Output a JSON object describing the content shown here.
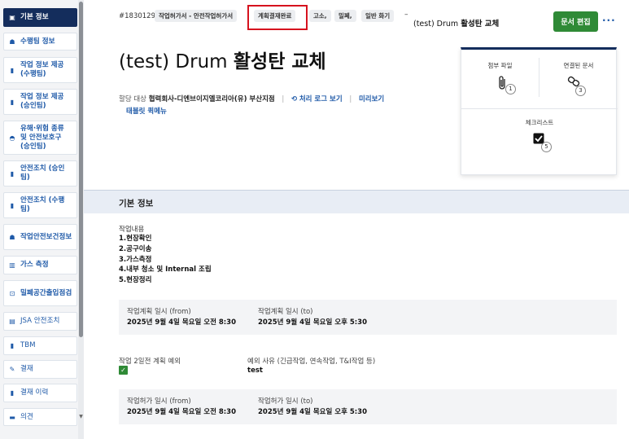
{
  "sidebar": {
    "items": [
      {
        "label": "기본 정보",
        "icon": "clipboard-icon"
      },
      {
        "label": "수행팀 정보",
        "icon": "team-icon"
      },
      {
        "label": "작업 정보 제공 (수행팀)",
        "icon": "document-icon"
      },
      {
        "label": "작업 정보 제공 (승인팀)",
        "icon": "document-icon"
      },
      {
        "label": "유해·위험 종류 및 안전보호구 (승인팀)",
        "icon": "goggles-icon"
      },
      {
        "label": "안전조치 (승인팀)",
        "icon": "document-icon"
      },
      {
        "label": "안전조치 (수행팀)",
        "icon": "document-icon"
      },
      {
        "label": "작업안전보건정보",
        "icon": "team-icon"
      },
      {
        "label": "가스 측정",
        "icon": "gas-icon"
      },
      {
        "label": "밀폐공간출입점검",
        "icon": "enter-icon"
      },
      {
        "label": "JSA 안전조치",
        "icon": "lock-icon"
      },
      {
        "label": "TBM",
        "icon": "document-icon"
      },
      {
        "label": "결재",
        "icon": "pen-icon"
      },
      {
        "label": "결재 이력",
        "icon": "document-icon"
      },
      {
        "label": "의견",
        "icon": "comment-icon"
      }
    ]
  },
  "header": {
    "doc_id": "#1830129",
    "tags": [
      "작업허가서 - 안전작업허가서",
      "계획결재완료",
      "고소,",
      "밀폐,",
      "일반 화기"
    ],
    "dash": "–",
    "title_prefix": "(test) Drum",
    "title_bold": "활성탄 교체",
    "edit_button": "문서 편집",
    "more": "···"
  },
  "page": {
    "title_prefix": "(test) Drum",
    "title_bold": "활성탄 교체"
  },
  "meta": {
    "assign_label": "할당 대상",
    "assign_value": "협력회사-디엔브이지엘코리아(유) 부산지점",
    "log_link": "처리 로그 보기",
    "preview_link": "미리보기",
    "tablet_link": "태블릿 퀵메뉴"
  },
  "card": {
    "attachments_label": "첨부 파일",
    "attachments_count": "1",
    "linked_label": "연결된 문서",
    "linked_count": "3",
    "checklist_label": "체크리스트",
    "checklist_count": "5"
  },
  "section": {
    "title": "기본 정보",
    "work_label": "작업내용",
    "work_items": [
      "1.현장확인",
      "2.공구이송",
      "3.가스측정",
      "4.내부 청소 및 Internal 조립",
      "5.현장정리"
    ],
    "plan_from_label": "작업계획 일시 (from)",
    "plan_from_value": "2025년 9월 4일 목요일 오전 8:30",
    "plan_to_label": "작업계획 일시 (to)",
    "plan_to_value": "2025년 9월 4일 목요일 오후 5:30",
    "pre_plan_label": "작업 2일전 계획 예외",
    "exception_label": "예외 사유 (긴급작업, 연속작업, T&I작업 등)",
    "exception_value": "test",
    "permit_from_label": "작업허가 일시 (from)",
    "permit_from_value": "2025년 9월 4일 목요일 오전 8:30",
    "permit_to_label": "작업허가 일시 (to)",
    "permit_to_value": "2025년 9월 4일 목요일 오후 5:30"
  },
  "colors": {
    "sidebar_active": "#142d5c",
    "link": "#1f5aa8",
    "edit_button": "#2f8a36",
    "highlight": "#d6121e"
  }
}
